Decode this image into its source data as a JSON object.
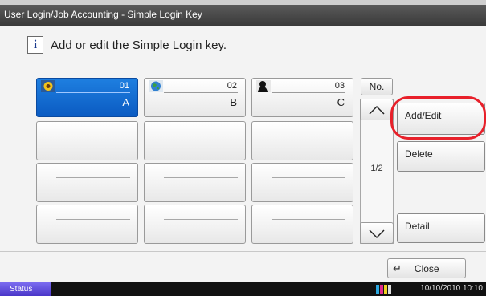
{
  "window": {
    "title": "User Login/Job Accounting - Simple Login Key"
  },
  "message": {
    "icon": "info-icon",
    "text": "Add or edit the Simple Login key."
  },
  "keys": [
    {
      "number": "01",
      "name": "A",
      "icon": "sunflower-icon",
      "selected": true
    },
    {
      "number": "02",
      "name": "B",
      "icon": "globe-icon",
      "selected": false
    },
    {
      "number": "03",
      "name": "C",
      "icon": "silhouette-icon",
      "selected": false
    }
  ],
  "pager": {
    "no_label": "No.",
    "page": "1/2"
  },
  "actions": {
    "add_edit": "Add/Edit",
    "delete": "Delete",
    "detail": "Detail"
  },
  "footer": {
    "close_icon": "enter-arrow-icon",
    "close": "Close"
  },
  "statusbar": {
    "status": "Status",
    "datetime": "10/10/2010  10:10"
  },
  "colors": {
    "selected_key": "#1e7fe0",
    "highlight_ring": "#e8202a",
    "status_button": "#5a48d8"
  }
}
